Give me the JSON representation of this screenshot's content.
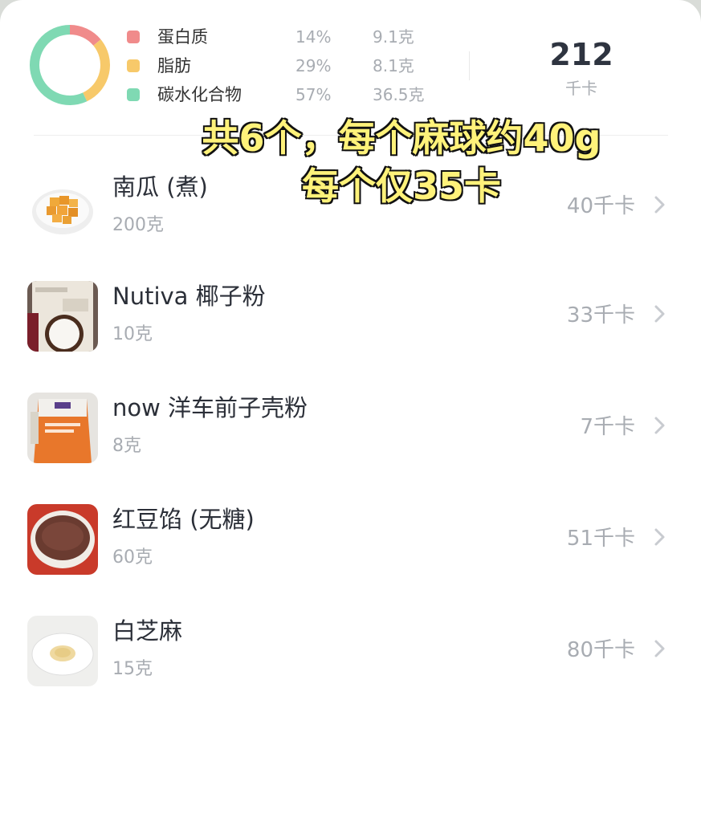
{
  "summary": {
    "macros": [
      {
        "name": "蛋白质",
        "pct": "14%",
        "grams": "9.1克",
        "color": "#f08b8b"
      },
      {
        "name": "脂肪",
        "pct": "29%",
        "grams": "8.1克",
        "color": "#f7c96a"
      },
      {
        "name": "碳水化合物",
        "pct": "57%",
        "grams": "36.5克",
        "color": "#7fd9b3"
      }
    ],
    "total": "212",
    "total_unit": "千卡"
  },
  "overlay": {
    "line1": "共6个，每个麻球约40g",
    "line2": "每个仅35卡"
  },
  "items": [
    {
      "name": "南瓜 (煮)",
      "qty": "200克",
      "kcal": "40千卡",
      "icon": "pumpkin-thumbnail"
    },
    {
      "name": "Nutiva 椰子粉",
      "qty": "10克",
      "kcal": "33千卡",
      "icon": "coconut-flour-thumbnail"
    },
    {
      "name": "now 洋车前子壳粉",
      "qty": "8克",
      "kcal": "7千卡",
      "icon": "psyllium-husk-thumbnail"
    },
    {
      "name": "红豆馅 (无糖)",
      "qty": "60克",
      "kcal": "51千卡",
      "icon": "red-bean-paste-thumbnail"
    },
    {
      "name": "白芝麻",
      "qty": "15克",
      "kcal": "80千卡",
      "icon": "white-sesame-thumbnail"
    }
  ]
}
